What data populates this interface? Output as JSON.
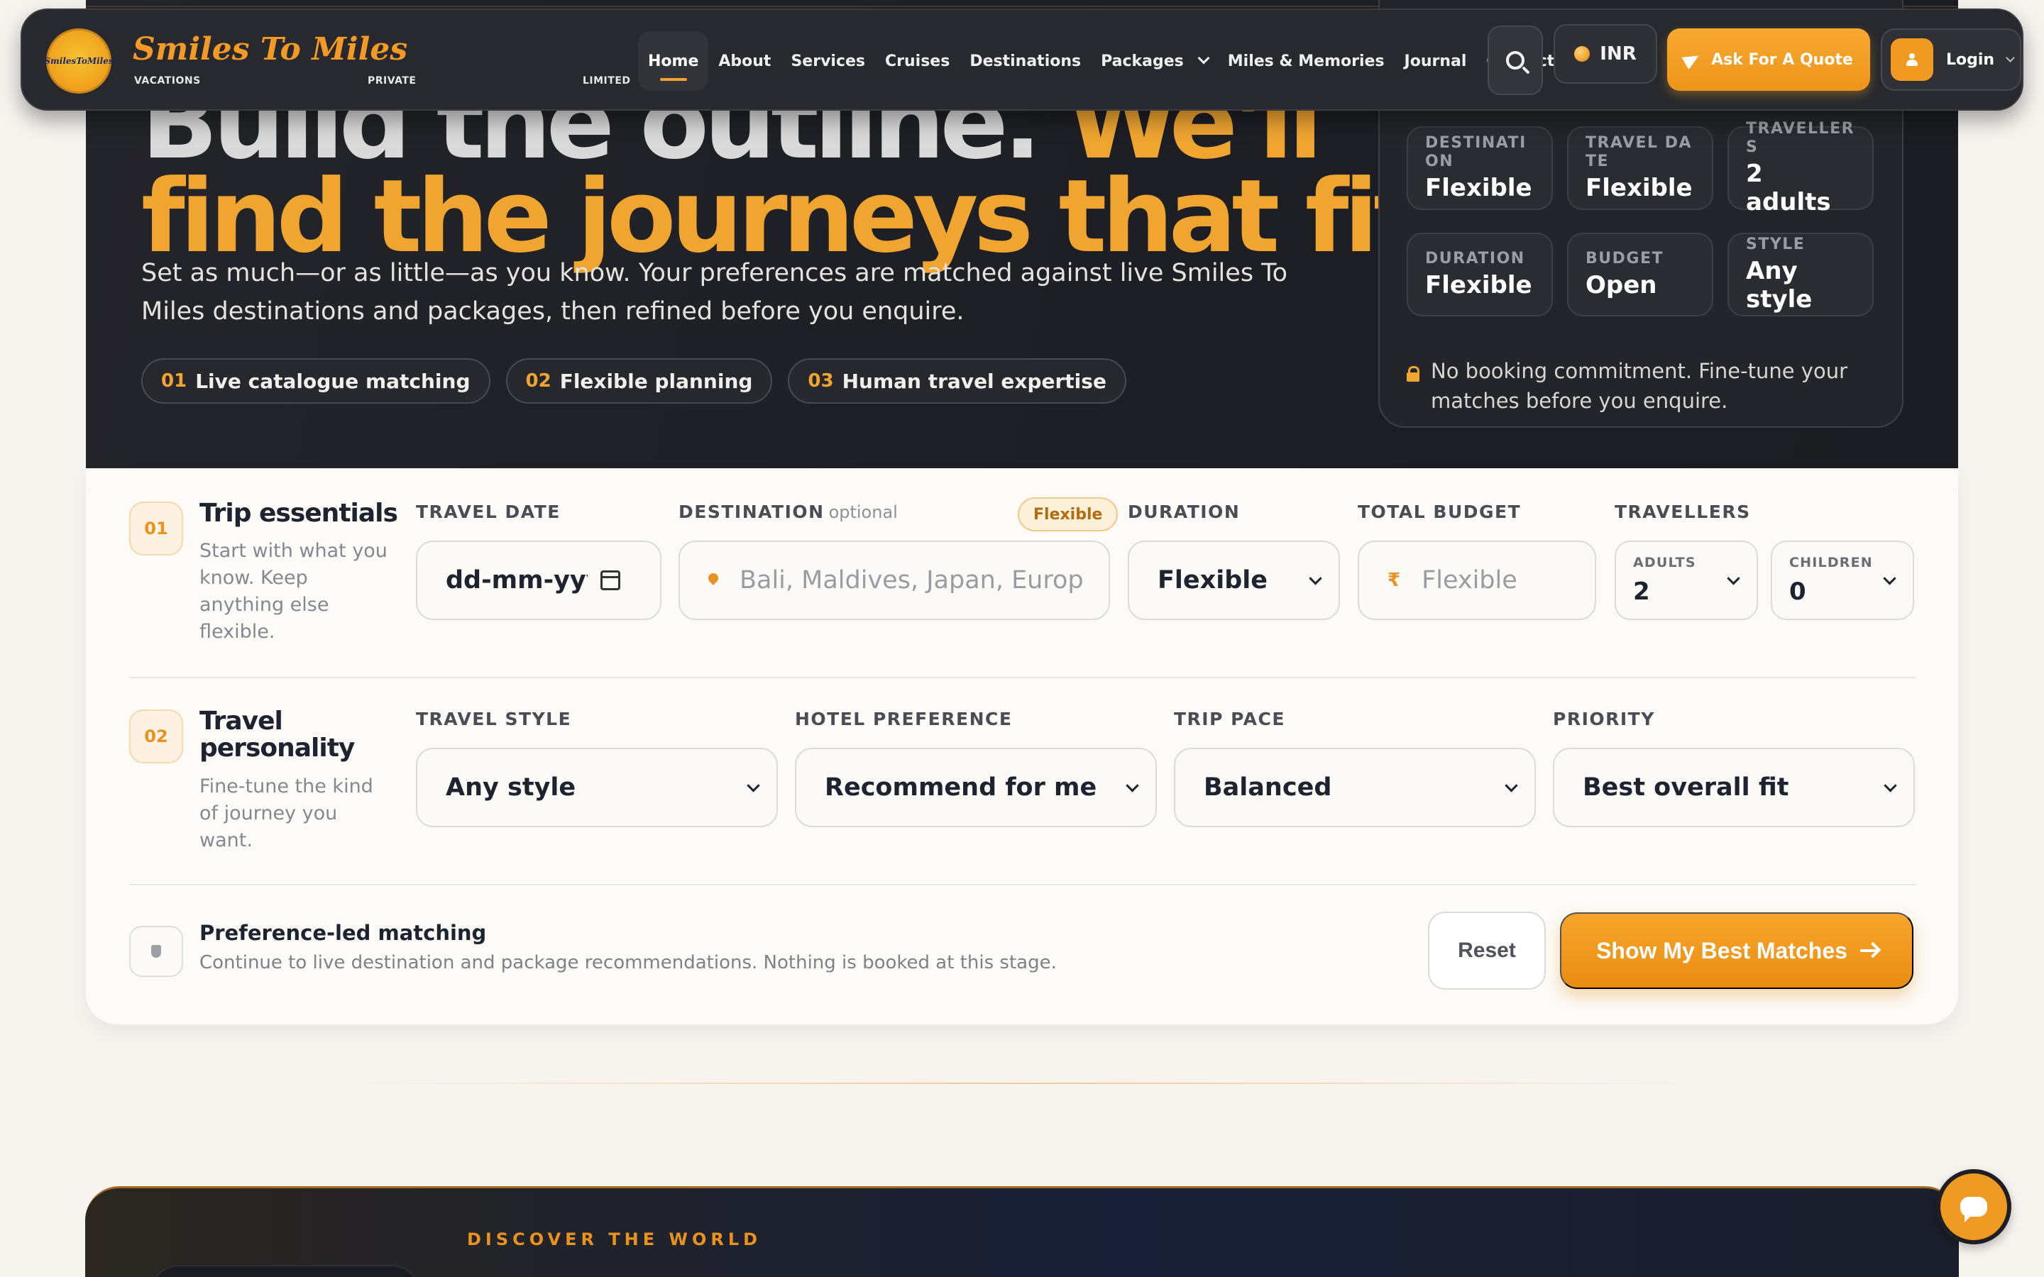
{
  "nav": {
    "logo_text": "SmilesToMiles",
    "brand_name": "Smiles To Miles",
    "brand_tagline": [
      "VACATIONS",
      "PRIVATE",
      "LIMITED"
    ],
    "links": [
      {
        "label": "Home",
        "active": true
      },
      {
        "label": "About"
      },
      {
        "label": "Services"
      },
      {
        "label": "Cruises"
      },
      {
        "label": "Destinations"
      },
      {
        "label": "Packages",
        "has_dropdown": true
      },
      {
        "label": "Miles & Memories"
      },
      {
        "label": "Journal"
      },
      {
        "label": "Contact"
      }
    ],
    "search_icon": "search-icon",
    "currency": "INR",
    "quote_label": "Ask For A Quote",
    "login_label": "Login"
  },
  "hero": {
    "headline_line1_a": "Build the outline.",
    "headline_line1_b": "We'll",
    "headline_line2": "find the journeys that fit.",
    "subtitle": "Set as much—or as little—as you know. Your preferences are matched against live Smiles To Miles destinations and packages, then refined before you enquire.",
    "chips": [
      {
        "num": "01",
        "label": "Live catalogue matching"
      },
      {
        "num": "02",
        "label": "Flexible planning"
      },
      {
        "num": "03",
        "label": "Human travel expertise"
      }
    ],
    "summary": {
      "cells": [
        {
          "key": "DESTINATION",
          "value": "Flexible"
        },
        {
          "key": "TRAVEL DATE",
          "value": "Flexible"
        },
        {
          "key": "TRAVELLERS",
          "value": "2 adults"
        },
        {
          "key": "DURATION",
          "value": "Flexible"
        },
        {
          "key": "BUDGET",
          "value": "Open"
        },
        {
          "key": "STYLE",
          "value": "Any style"
        }
      ],
      "note": "No booking commitment. Fine-tune your matches before you enquire."
    }
  },
  "form": {
    "step1": {
      "num": "01",
      "title": "Trip essentials",
      "desc": "Start with what you know. Keep anything else flexible.",
      "travel_date": {
        "label": "TRAVEL DATE",
        "placeholder": "dd-mm-yyyy"
      },
      "destination": {
        "label": "DESTINATION",
        "optional": "optional",
        "badge": "Flexible",
        "placeholder": "Bali, Maldives, Japan, Europe"
      },
      "duration": {
        "label": "DURATION",
        "value": "Flexible"
      },
      "budget": {
        "label": "TOTAL BUDGET",
        "currency_symbol": "₹",
        "placeholder": "Flexible"
      },
      "travellers": {
        "label": "TRAVELLERS",
        "adults_label": "ADULTS",
        "adults_value": "2",
        "children_label": "CHILDREN",
        "children_value": "0"
      }
    },
    "step2": {
      "num": "02",
      "title": "Travel personality",
      "desc": "Fine-tune the kind of journey you want.",
      "travel_style": {
        "label": "TRAVEL STYLE",
        "value": "Any style"
      },
      "hotel": {
        "label": "HOTEL PREFERENCE",
        "value": "Recommend for me"
      },
      "pace": {
        "label": "TRIP PACE",
        "value": "Balanced"
      },
      "priority": {
        "label": "PRIORITY",
        "value": "Best overall fit"
      }
    },
    "footer": {
      "title": "Preference-led matching",
      "desc": "Continue to live destination and package recommendations. Nothing is booked at this stage.",
      "reset_label": "Reset",
      "submit_label": "Show My Best Matches"
    }
  },
  "discover": {
    "kicker": "DISCOVER THE WORLD"
  },
  "chat": {
    "icon": "chat-icon"
  },
  "colors": {
    "accent": "#f0a531",
    "dark": "#23252a",
    "panel": "#fcfbf8"
  }
}
